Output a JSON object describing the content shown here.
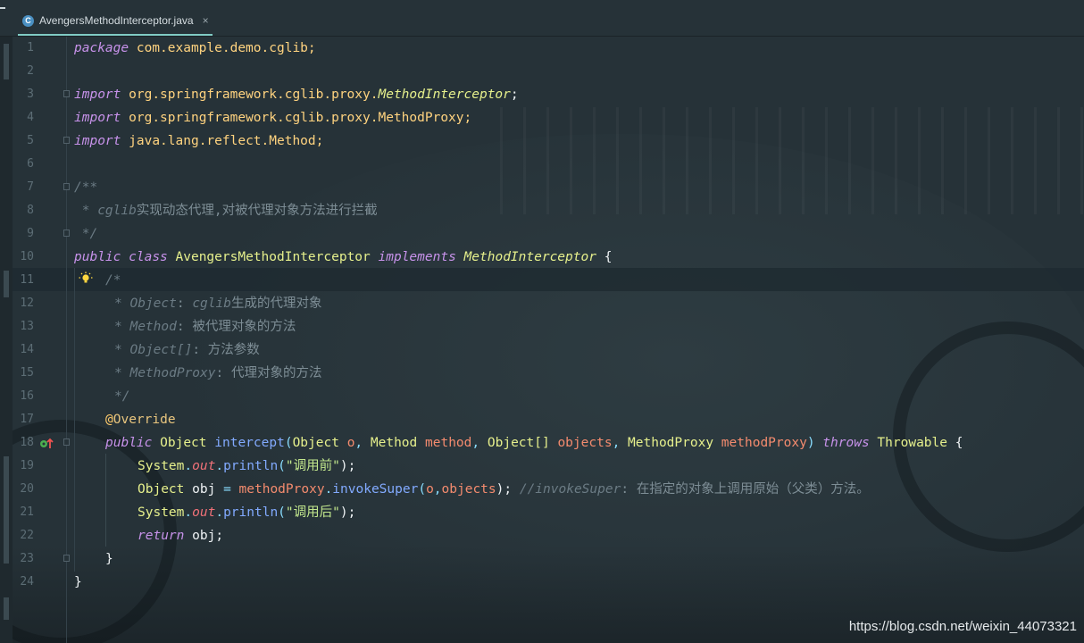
{
  "editor": {
    "tab": {
      "filename": "AvengersMethodInterceptor.java",
      "file_icon": "C",
      "close": "×"
    },
    "line_numbers": [
      "1",
      "2",
      "3",
      "4",
      "5",
      "6",
      "7",
      "8",
      "9",
      "10",
      "11",
      "12",
      "13",
      "14",
      "15",
      "16",
      "17",
      "18",
      "19",
      "20",
      "21",
      "22",
      "23",
      "24"
    ],
    "code": {
      "l1": {
        "kw": "package",
        "name": "com.example.demo.cglib;"
      },
      "l3": {
        "kw": "import",
        "pkg": "org.springframework.cglib.proxy.",
        "cls": "MethodInterceptor",
        "end": ";"
      },
      "l4": {
        "kw": "import",
        "pkg": "org.springframework.cglib.proxy.MethodProxy;"
      },
      "l5": {
        "kw": "import",
        "pkg": "java.lang.reflect.Method;"
      },
      "l7": {
        "text": "/**"
      },
      "l8": {
        "star": " * ",
        "cm": "cglib",
        "cn": "实现动态代理,对被代理对象方法进行拦截"
      },
      "l9": {
        "text": " */"
      },
      "l10": {
        "kw1": "public",
        "kw2": "class",
        "name": "AvengersMethodInterceptor",
        "kw3": "implements",
        "iface": "MethodInterceptor",
        "brace": "{"
      },
      "l11": {
        "text": "/*"
      },
      "l12": {
        "star": "* ",
        "cm": "Object",
        "colon": ": ",
        "cm2": "cglib",
        "cn": "生成的代理对象"
      },
      "l13": {
        "star": "* ",
        "cm": "Method",
        "colon": ": ",
        "cn": "被代理对象的方法"
      },
      "l14": {
        "star": "* ",
        "cm": "Object[]",
        "colon": ": ",
        "cn": "方法参数"
      },
      "l15": {
        "star": "* ",
        "cm": "MethodProxy",
        "colon": ": ",
        "cn": "代理对象的方法"
      },
      "l16": {
        "text": "*/"
      },
      "l17": {
        "at": "@",
        "ann": "Override"
      },
      "l18": {
        "kw1": "public",
        "ret": "Object",
        "fn": "intercept",
        "open": "(",
        "t1": "Object",
        "p1": "o",
        "c1": ",",
        "t2": "Method",
        "p2": "method",
        "c2": ",",
        "t3": "Object[]",
        "p3": "objects",
        "c3": ",",
        "t4": "MethodProxy",
        "p4": "methodProxy",
        "close": ")",
        "kw2": "throws",
        "ex": "Throwable",
        "brace": "{"
      },
      "l19": {
        "obj": "System",
        "dot": ".",
        "fld": "out",
        "dot2": ".",
        "fn": "println",
        "open": "(",
        "str": "\"调用前\"",
        "end": ");"
      },
      "l20": {
        "type": "Object",
        "var": "obj",
        "eq": "=",
        "recv": "methodProxy",
        "dot": ".",
        "fn": "invokeSuper",
        "open": "(",
        "a1": "o",
        "comma": ",",
        "a2": "objects",
        "end": ");",
        "cmt": "//invokeSuper",
        "colon": ": ",
        "cn": "在指定的对象上调用原始（父类）方法。"
      },
      "l21": {
        "obj": "System",
        "dot": ".",
        "fld": "out",
        "dot2": ".",
        "fn": "println",
        "open": "(",
        "str": "\"调用后\"",
        "end": ");"
      },
      "l22": {
        "kw": "return",
        "rest": "obj;"
      },
      "l23": {
        "text": "}"
      },
      "l24": {
        "text": "}"
      }
    },
    "gutter_icons": {
      "bulb": "bulb-icon",
      "override_marker": "override-method-icon"
    }
  },
  "watermark": "https://blog.csdn.net/weixin_44073321",
  "colors": {
    "background": "#263238",
    "keyword": "#c792ea",
    "class": "#e6f08c",
    "function": "#82aaff",
    "string": "#c3e88d",
    "comment": "#6b7b84",
    "field": "#f07178",
    "annotation": "#ffcb6b",
    "tab_accent": "#80cbc4"
  }
}
